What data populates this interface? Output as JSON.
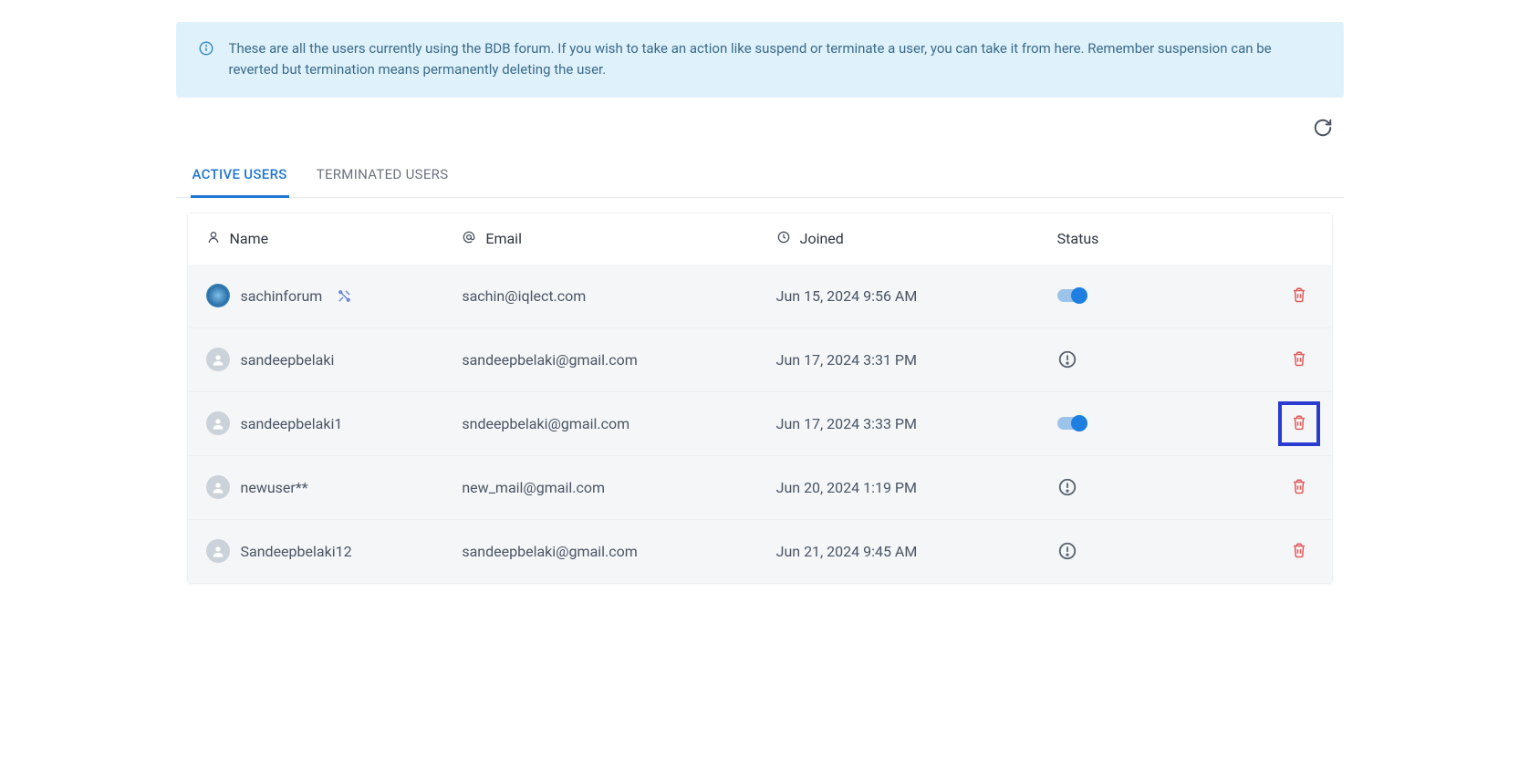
{
  "alert": {
    "text": "These are all the users currently using the BDB forum. If you wish to take an action like suspend or terminate a user, you can take it from here. Remember suspension can be reverted but termination means permanently deleting the user."
  },
  "tabs": {
    "active": "ACTIVE USERS",
    "terminated": "TERMINATED USERS"
  },
  "columns": {
    "name": "Name",
    "email": "Email",
    "joined": "Joined",
    "status": "Status"
  },
  "users": [
    {
      "name": "sachinforum",
      "email": "sachin@iqlect.com",
      "joined": "Jun 15, 2024 9:56 AM",
      "status": "toggle",
      "avatar": "special",
      "badge": true,
      "highlight_delete": false
    },
    {
      "name": "sandeepbelaki",
      "email": "sandeepbelaki@gmail.com",
      "joined": "Jun 17, 2024 3:31 PM",
      "status": "alert",
      "avatar": "generic",
      "badge": false,
      "highlight_delete": false
    },
    {
      "name": "sandeepbelaki1",
      "email": "sndeepbelaki@gmail.com",
      "joined": "Jun 17, 2024 3:33 PM",
      "status": "toggle",
      "avatar": "generic",
      "badge": false,
      "highlight_delete": true
    },
    {
      "name": "newuser**",
      "email": "new_mail@gmail.com",
      "joined": "Jun 20, 2024 1:19 PM",
      "status": "alert",
      "avatar": "generic",
      "badge": false,
      "highlight_delete": false
    },
    {
      "name": "Sandeepbelaki12",
      "email": "sandeepbelaki@gmail.com",
      "joined": "Jun 21, 2024 9:45 AM",
      "status": "alert",
      "avatar": "generic",
      "badge": false,
      "highlight_delete": false
    }
  ]
}
